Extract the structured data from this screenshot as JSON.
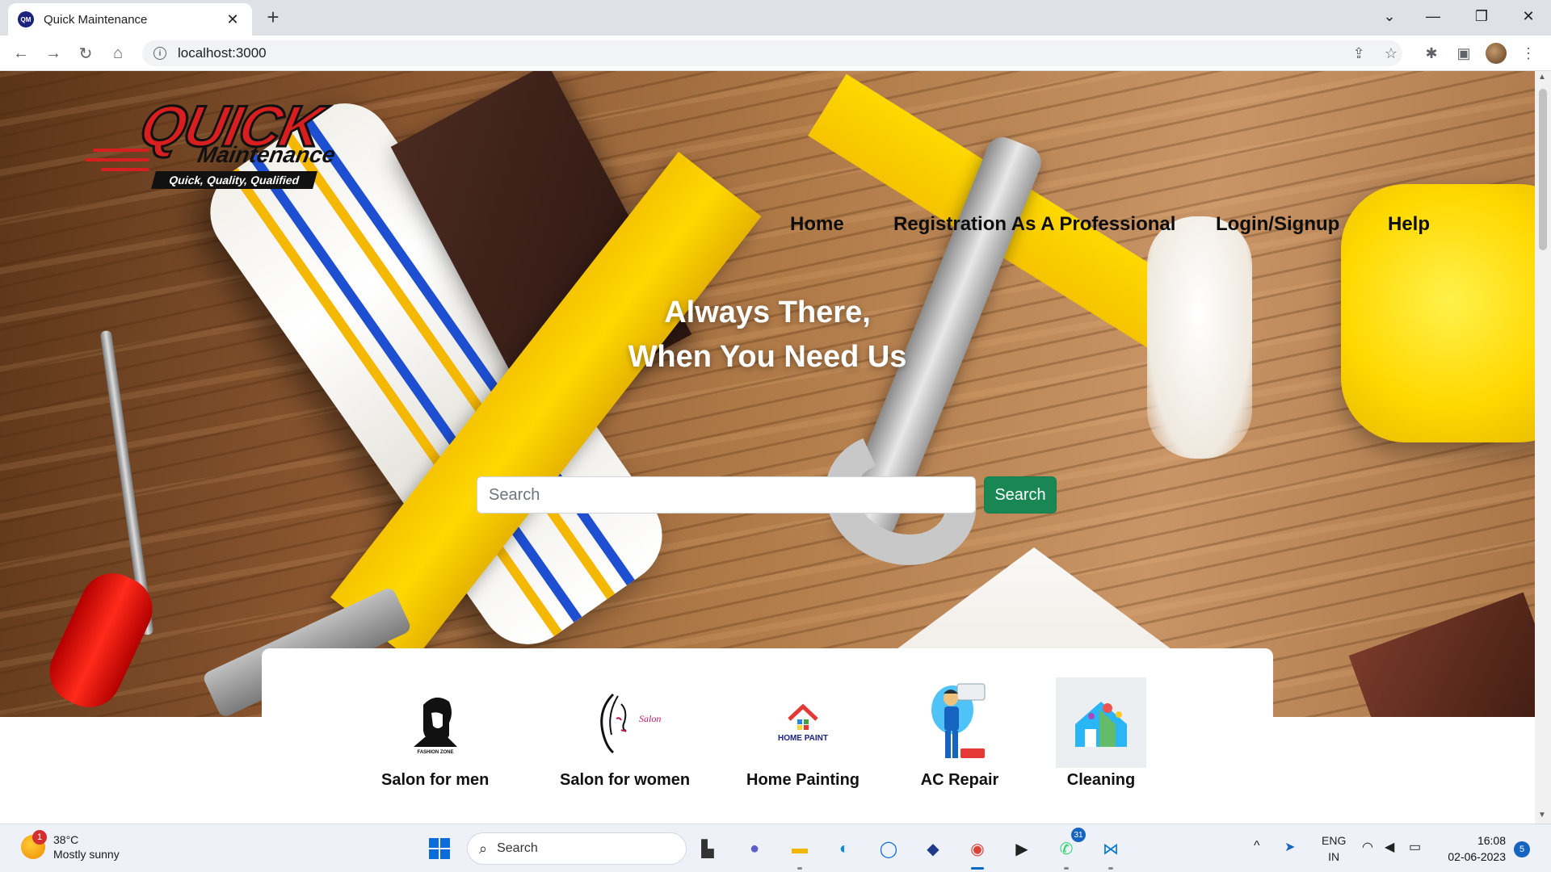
{
  "browser": {
    "tab_title": "Quick Maintenance",
    "favicon_text": "QM",
    "close_glyph": "✕",
    "new_tab_glyph": "+",
    "url": "localhost:3000",
    "window_controls": [
      "⌄",
      "—",
      "❐",
      "✕"
    ]
  },
  "logo": {
    "line1": "QUICK",
    "line2": "Maintenance",
    "tagline": "Quick, Quality, Qualified"
  },
  "nav": {
    "items": [
      "Home",
      "Registration As A Professional",
      "Login/Signup",
      "Help"
    ]
  },
  "hero": {
    "headline_line1": "Always There,",
    "headline_line2": "When You Need Us"
  },
  "search": {
    "placeholder": "Search",
    "button_label": "Search",
    "button_color": "#198754"
  },
  "services": [
    {
      "label": "Salon for men",
      "icon": "bearded-man-icon",
      "caption": "FASHION ZONE"
    },
    {
      "label": "Salon for women",
      "icon": "woman-face-icon",
      "caption": "Salon"
    },
    {
      "label": "Home Painting",
      "icon": "home-paint-icon",
      "caption": "HOME PAINT"
    },
    {
      "label": "AC Repair",
      "icon": "technician-icon",
      "caption": ""
    },
    {
      "label": "Cleaning",
      "icon": "house-cleaning-icon",
      "caption": ""
    }
  ],
  "taskbar": {
    "weather_temp": "38°C",
    "weather_desc": "Mostly sunny",
    "weather_badge": "1",
    "search_label": "Search",
    "whatsapp_badge": "31",
    "language_line1": "ENG",
    "language_line2": "IN",
    "time": "16:08",
    "date": "02-06-2023",
    "notification_count": "5"
  }
}
